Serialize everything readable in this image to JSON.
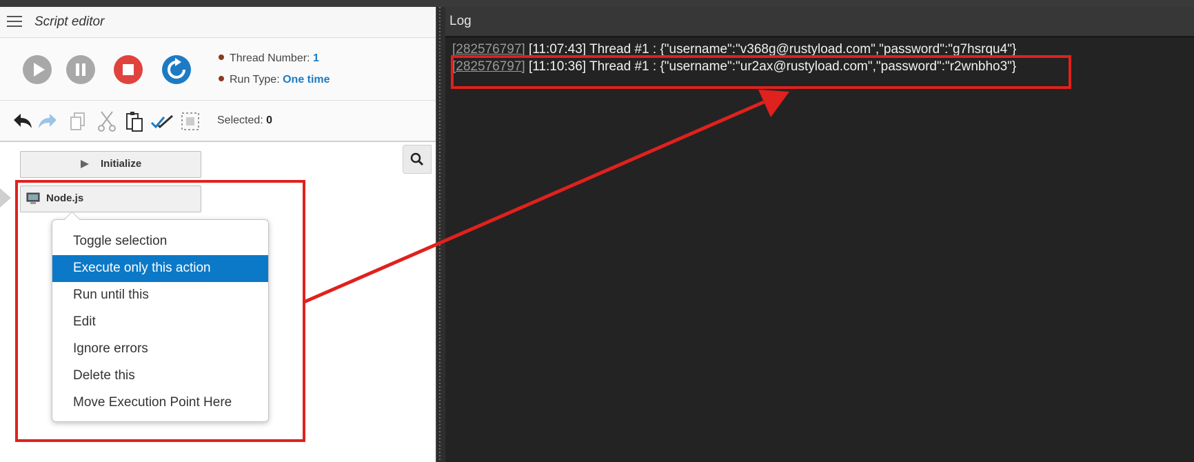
{
  "editor": {
    "title": "Script editor",
    "thread_number_label": "Thread Number:",
    "thread_number_value": "1",
    "run_type_label": "Run Type:",
    "run_type_value": "One time",
    "selected_label": "Selected:",
    "selected_value": "0"
  },
  "nodes": {
    "initialize": "Initialize",
    "nodejs": "Node.js"
  },
  "context_menu": {
    "items": [
      "Toggle selection",
      "Execute only this action",
      "Run until this",
      "Edit",
      "Ignore errors",
      "Delete this",
      "Move Execution Point Here"
    ],
    "active_index": 1
  },
  "log": {
    "title": "Log",
    "lines": [
      {
        "id": "[282576797]",
        "text": " [11:07:43] Thread #1 : {\"username\":\"v368g@rustyload.com\",\"password\":\"g7hsrqu4\"}"
      },
      {
        "id": "[282576797]",
        "text": " [11:10:36] Thread #1 : {\"username\":\"ur2ax@rustyload.com\",\"password\":\"r2wnbho3\"}"
      }
    ]
  },
  "colors": {
    "accent_blue": "#1d7bc3",
    "menu_highlight": "#0b79c7",
    "stop_red": "#e0423e",
    "annotation_red": "#e0211d",
    "log_bg": "#232323"
  }
}
